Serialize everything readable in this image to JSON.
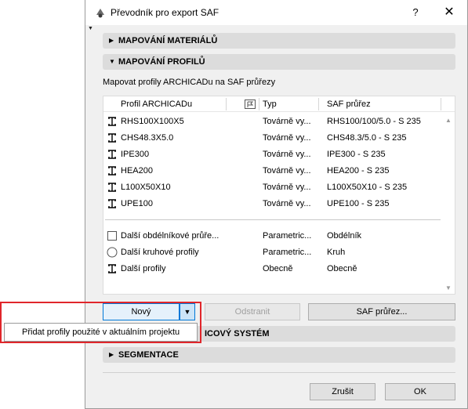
{
  "window": {
    "title": "Převodník pro export SAF",
    "help_label": "?",
    "close_label": "✕"
  },
  "sections": {
    "materials": "MAPOVÁNÍ MATERIÁLŮ",
    "profiles": "MAPOVÁNÍ PROFILŮ",
    "coordinate_partial": "ICOVÝ SYSTÉM",
    "segmentation": "SEGMENTACE"
  },
  "profiles": {
    "label": "Mapovat profily ARCHICADu na SAF průřezy",
    "columns": {
      "name": "Profil ARCHICADu",
      "type": "Typ",
      "saf": "SAF průřez"
    },
    "rows": [
      {
        "name": "RHS100X100X5",
        "type": "Továrně vy...",
        "saf": "RHS100/100/5.0 - S 235",
        "icon": "profile-icon"
      },
      {
        "name": "CHS48.3X5.0",
        "type": "Továrně vy...",
        "saf": "CHS48.3/5.0 - S 235",
        "icon": "profile-icon"
      },
      {
        "name": "IPE300",
        "type": "Továrně vy...",
        "saf": "IPE300 - S 235",
        "icon": "profile-icon"
      },
      {
        "name": "HEA200",
        "type": "Továrně vy...",
        "saf": "HEA200 - S 235",
        "icon": "profile-icon"
      },
      {
        "name": "L100X50X10",
        "type": "Továrně vy...",
        "saf": "L100X50X10 - S 235",
        "icon": "profile-icon"
      },
      {
        "name": "UPE100",
        "type": "Továrně vy...",
        "saf": "UPE100 - S 235",
        "icon": "profile-icon"
      }
    ],
    "other_rows": [
      {
        "name": "Další obdélníkové průře...",
        "type": "Parametric...",
        "saf": "Obdélník",
        "icon": "rectangle-icon"
      },
      {
        "name": "Další kruhové profily",
        "type": "Parametric...",
        "saf": "Kruh",
        "icon": "circle-icon"
      },
      {
        "name": "Další profily",
        "type": "Obecně",
        "saf": "Obecně",
        "icon": "profile-icon"
      }
    ]
  },
  "buttons": {
    "new": "Nový",
    "remove": "Odstranit",
    "saf": "SAF průřez...",
    "cancel": "Zrušit",
    "ok": "OK"
  },
  "popup": {
    "item": "Přidat profily použité v aktuálním projektu"
  },
  "colors": {
    "highlight": "#e0262b",
    "section_bg": "#dcdcdc",
    "dialog_bg": "#f0f0f0",
    "accent": "#0078d7"
  }
}
